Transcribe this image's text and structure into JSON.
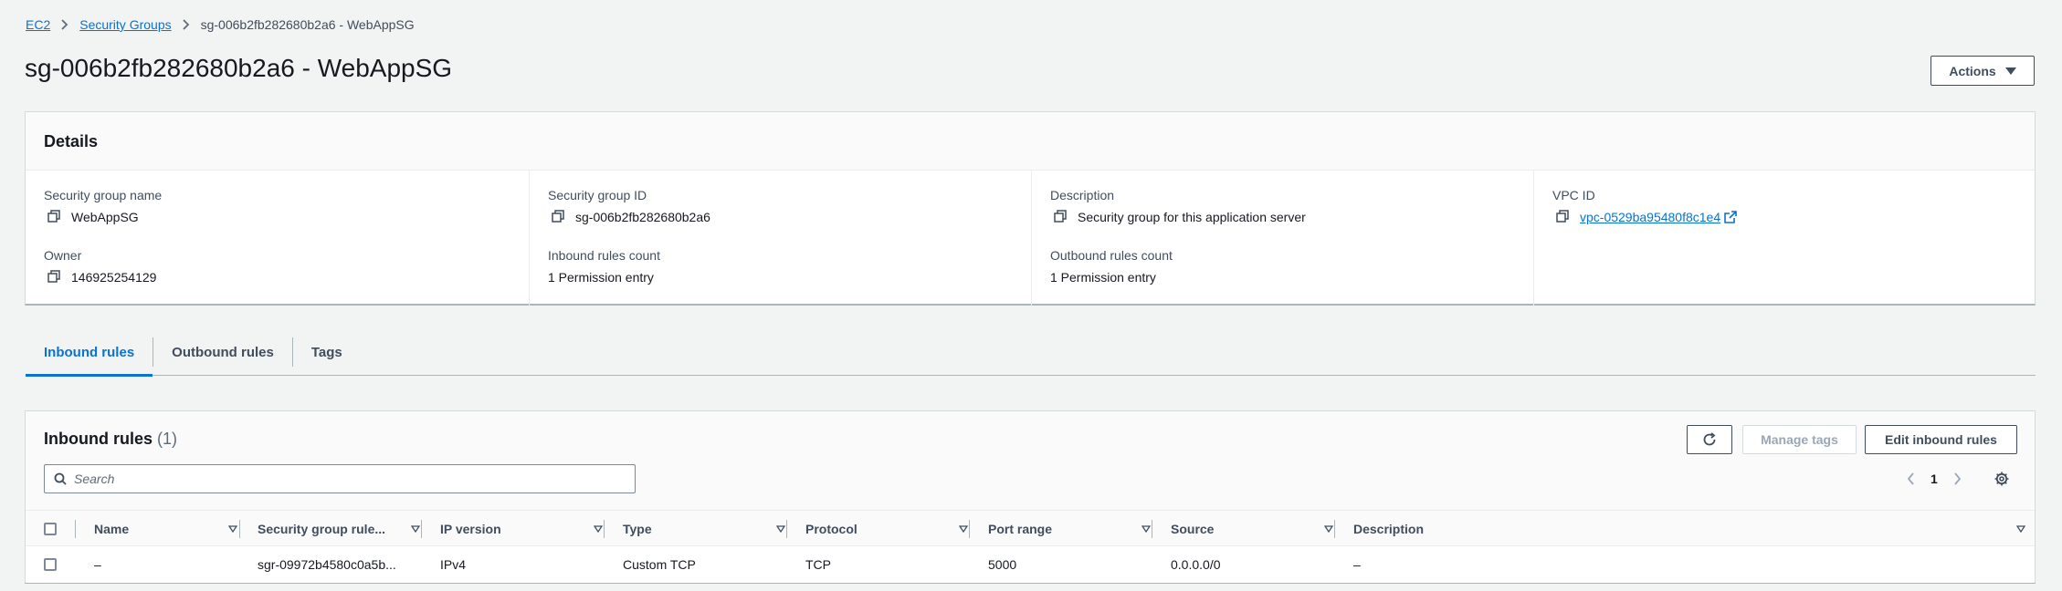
{
  "breadcrumb": {
    "items": [
      "EC2",
      "Security Groups"
    ],
    "current": "sg-006b2fb282680b2a6 - WebAppSG"
  },
  "page_title": "sg-006b2fb282680b2a6 - WebAppSG",
  "actions_label": "Actions",
  "details": {
    "heading": "Details",
    "fields": {
      "sg_name": {
        "label": "Security group name",
        "value": "WebAppSG"
      },
      "sg_id": {
        "label": "Security group ID",
        "value": "sg-006b2fb282680b2a6"
      },
      "description": {
        "label": "Description",
        "value": "Security group for this application server"
      },
      "vpc_id": {
        "label": "VPC ID",
        "value": "vpc-0529ba95480f8c1e4"
      },
      "owner": {
        "label": "Owner",
        "value": "146925254129"
      },
      "inbound_count": {
        "label": "Inbound rules count",
        "value": "1 Permission entry"
      },
      "outbound_count": {
        "label": "Outbound rules count",
        "value": "1 Permission entry"
      }
    }
  },
  "tabs": [
    "Inbound rules",
    "Outbound rules",
    "Tags"
  ],
  "inbound": {
    "title": "Inbound rules",
    "count": "(1)",
    "manage_tags_label": "Manage tags",
    "edit_label": "Edit inbound rules",
    "search_placeholder": "Search",
    "page": "1",
    "columns": [
      "Name",
      "Security group rule...",
      "IP version",
      "Type",
      "Protocol",
      "Port range",
      "Source",
      "Description"
    ],
    "rows": [
      [
        "–",
        "sgr-09972b4580c0a5b...",
        "IPv4",
        "Custom TCP",
        "TCP",
        "5000",
        "0.0.0.0/0",
        "–"
      ]
    ]
  },
  "colors": {
    "link": "#0972d3",
    "background": "#f2f3f3",
    "text": "#16191f",
    "muted": "#414d5c"
  },
  "icons": [
    "chevron-right-icon",
    "caret-down-icon",
    "copy-icon",
    "external-link-icon",
    "refresh-icon",
    "search-icon",
    "chevron-left-icon",
    "settings-icon",
    "sort-icon"
  ]
}
